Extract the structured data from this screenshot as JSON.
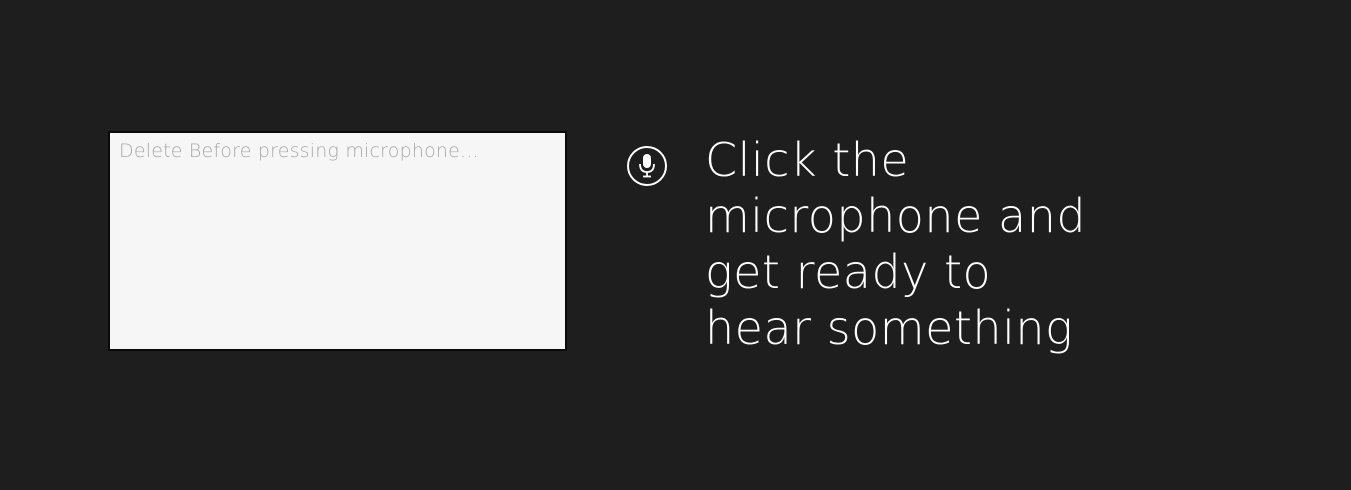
{
  "input": {
    "placeholder": "Delete Before pressing microphone...",
    "value": ""
  },
  "mic": {
    "icon": "microphone-icon",
    "color": "#ffffff"
  },
  "instructions": {
    "line1": "Click the",
    "line2": "microphone and",
    "line3": "get ready to",
    "line4": "hear something"
  },
  "colors": {
    "background": "#1e1e1e",
    "input_background": "#f7f6f7",
    "text": "#ffffff"
  }
}
